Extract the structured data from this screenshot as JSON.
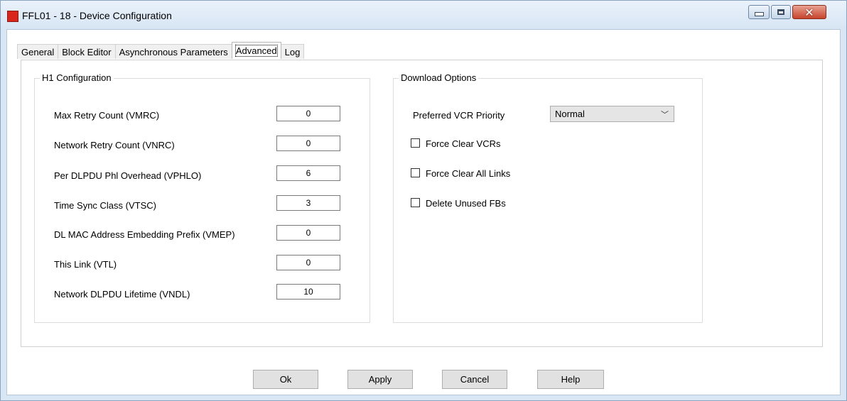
{
  "window": {
    "title": "FFL01 - 18 - Device Configuration",
    "controls": {
      "minimize_icon": "minimize-icon",
      "maximize_icon": "maximize-icon",
      "close_icon": "close-icon",
      "close_glyph": "✕"
    }
  },
  "tabs": [
    {
      "label": "General"
    },
    {
      "label": "Block Editor"
    },
    {
      "label": "Asynchronous Parameters"
    },
    {
      "label": "Advanced"
    },
    {
      "label": "Log"
    }
  ],
  "active_tab": "Advanced",
  "h1_config": {
    "title": "H1 Configuration",
    "fields": [
      {
        "label": "Max Retry Count (VMRC)",
        "value": "0"
      },
      {
        "label": "Network Retry Count (VNRC)",
        "value": "0"
      },
      {
        "label": "Per DLPDU Phl Overhead (VPHLO)",
        "value": "6"
      },
      {
        "label": "Time Sync Class (VTSC)",
        "value": "3"
      },
      {
        "label": "DL MAC Address Embedding Prefix (VMEP)",
        "value": "0"
      },
      {
        "label": "This Link (VTL)",
        "value": "0"
      },
      {
        "label": "Network DLPDU Lifetime (VNDL)",
        "value": "10"
      }
    ]
  },
  "download_options": {
    "title": "Download Options",
    "priority_label": "Preferred VCR Priority",
    "priority_value": "Normal",
    "chevron": "﹀",
    "checkboxes": [
      {
        "label": "Force Clear VCRs",
        "checked": false
      },
      {
        "label": "Force Clear All Links",
        "checked": false
      },
      {
        "label": "Delete Unused FBs",
        "checked": false
      }
    ]
  },
  "buttons": {
    "ok": "Ok",
    "apply": "Apply",
    "cancel": "Cancel",
    "help": "Help"
  },
  "colors": {
    "title_bar": "#d7e5f4",
    "close_button": "#c7432b",
    "app_icon": "#d9261c"
  }
}
